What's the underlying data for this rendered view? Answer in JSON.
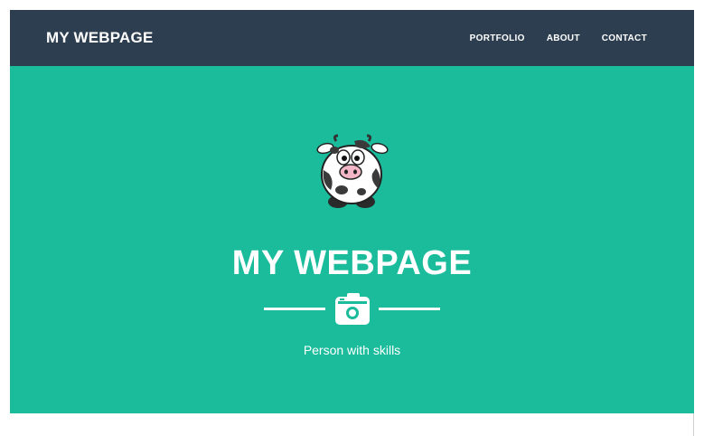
{
  "navbar": {
    "brand": "MY WEBPAGE",
    "links": [
      "PORTFOLIO",
      "ABOUT",
      "CONTACT"
    ],
    "background": "#2c3e50"
  },
  "hero": {
    "title": "MY WEBPAGE",
    "subtitle": "Person with skills",
    "avatar_icon": "cow-icon",
    "divider_icon": "camera-icon",
    "background": "#1abc9c",
    "text_color": "#ffffff"
  }
}
